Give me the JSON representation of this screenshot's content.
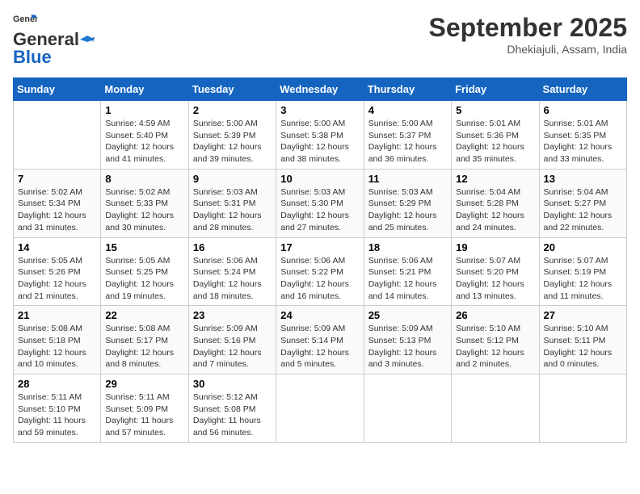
{
  "header": {
    "logo_line1": "General",
    "logo_line2": "Blue",
    "month": "September 2025",
    "location": "Dhekiajuli, Assam, India"
  },
  "weekdays": [
    "Sunday",
    "Monday",
    "Tuesday",
    "Wednesday",
    "Thursday",
    "Friday",
    "Saturday"
  ],
  "weeks": [
    [
      {
        "day": "",
        "detail": ""
      },
      {
        "day": "1",
        "detail": "Sunrise: 4:59 AM\nSunset: 5:40 PM\nDaylight: 12 hours\nand 41 minutes."
      },
      {
        "day": "2",
        "detail": "Sunrise: 5:00 AM\nSunset: 5:39 PM\nDaylight: 12 hours\nand 39 minutes."
      },
      {
        "day": "3",
        "detail": "Sunrise: 5:00 AM\nSunset: 5:38 PM\nDaylight: 12 hours\nand 38 minutes."
      },
      {
        "day": "4",
        "detail": "Sunrise: 5:00 AM\nSunset: 5:37 PM\nDaylight: 12 hours\nand 36 minutes."
      },
      {
        "day": "5",
        "detail": "Sunrise: 5:01 AM\nSunset: 5:36 PM\nDaylight: 12 hours\nand 35 minutes."
      },
      {
        "day": "6",
        "detail": "Sunrise: 5:01 AM\nSunset: 5:35 PM\nDaylight: 12 hours\nand 33 minutes."
      }
    ],
    [
      {
        "day": "7",
        "detail": "Sunrise: 5:02 AM\nSunset: 5:34 PM\nDaylight: 12 hours\nand 31 minutes."
      },
      {
        "day": "8",
        "detail": "Sunrise: 5:02 AM\nSunset: 5:33 PM\nDaylight: 12 hours\nand 30 minutes."
      },
      {
        "day": "9",
        "detail": "Sunrise: 5:03 AM\nSunset: 5:31 PM\nDaylight: 12 hours\nand 28 minutes."
      },
      {
        "day": "10",
        "detail": "Sunrise: 5:03 AM\nSunset: 5:30 PM\nDaylight: 12 hours\nand 27 minutes."
      },
      {
        "day": "11",
        "detail": "Sunrise: 5:03 AM\nSunset: 5:29 PM\nDaylight: 12 hours\nand 25 minutes."
      },
      {
        "day": "12",
        "detail": "Sunrise: 5:04 AM\nSunset: 5:28 PM\nDaylight: 12 hours\nand 24 minutes."
      },
      {
        "day": "13",
        "detail": "Sunrise: 5:04 AM\nSunset: 5:27 PM\nDaylight: 12 hours\nand 22 minutes."
      }
    ],
    [
      {
        "day": "14",
        "detail": "Sunrise: 5:05 AM\nSunset: 5:26 PM\nDaylight: 12 hours\nand 21 minutes."
      },
      {
        "day": "15",
        "detail": "Sunrise: 5:05 AM\nSunset: 5:25 PM\nDaylight: 12 hours\nand 19 minutes."
      },
      {
        "day": "16",
        "detail": "Sunrise: 5:06 AM\nSunset: 5:24 PM\nDaylight: 12 hours\nand 18 minutes."
      },
      {
        "day": "17",
        "detail": "Sunrise: 5:06 AM\nSunset: 5:22 PM\nDaylight: 12 hours\nand 16 minutes."
      },
      {
        "day": "18",
        "detail": "Sunrise: 5:06 AM\nSunset: 5:21 PM\nDaylight: 12 hours\nand 14 minutes."
      },
      {
        "day": "19",
        "detail": "Sunrise: 5:07 AM\nSunset: 5:20 PM\nDaylight: 12 hours\nand 13 minutes."
      },
      {
        "day": "20",
        "detail": "Sunrise: 5:07 AM\nSunset: 5:19 PM\nDaylight: 12 hours\nand 11 minutes."
      }
    ],
    [
      {
        "day": "21",
        "detail": "Sunrise: 5:08 AM\nSunset: 5:18 PM\nDaylight: 12 hours\nand 10 minutes."
      },
      {
        "day": "22",
        "detail": "Sunrise: 5:08 AM\nSunset: 5:17 PM\nDaylight: 12 hours\nand 8 minutes."
      },
      {
        "day": "23",
        "detail": "Sunrise: 5:09 AM\nSunset: 5:16 PM\nDaylight: 12 hours\nand 7 minutes."
      },
      {
        "day": "24",
        "detail": "Sunrise: 5:09 AM\nSunset: 5:14 PM\nDaylight: 12 hours\nand 5 minutes."
      },
      {
        "day": "25",
        "detail": "Sunrise: 5:09 AM\nSunset: 5:13 PM\nDaylight: 12 hours\nand 3 minutes."
      },
      {
        "day": "26",
        "detail": "Sunrise: 5:10 AM\nSunset: 5:12 PM\nDaylight: 12 hours\nand 2 minutes."
      },
      {
        "day": "27",
        "detail": "Sunrise: 5:10 AM\nSunset: 5:11 PM\nDaylight: 12 hours\nand 0 minutes."
      }
    ],
    [
      {
        "day": "28",
        "detail": "Sunrise: 5:11 AM\nSunset: 5:10 PM\nDaylight: 11 hours\nand 59 minutes."
      },
      {
        "day": "29",
        "detail": "Sunrise: 5:11 AM\nSunset: 5:09 PM\nDaylight: 11 hours\nand 57 minutes."
      },
      {
        "day": "30",
        "detail": "Sunrise: 5:12 AM\nSunset: 5:08 PM\nDaylight: 11 hours\nand 56 minutes."
      },
      {
        "day": "",
        "detail": ""
      },
      {
        "day": "",
        "detail": ""
      },
      {
        "day": "",
        "detail": ""
      },
      {
        "day": "",
        "detail": ""
      }
    ]
  ]
}
